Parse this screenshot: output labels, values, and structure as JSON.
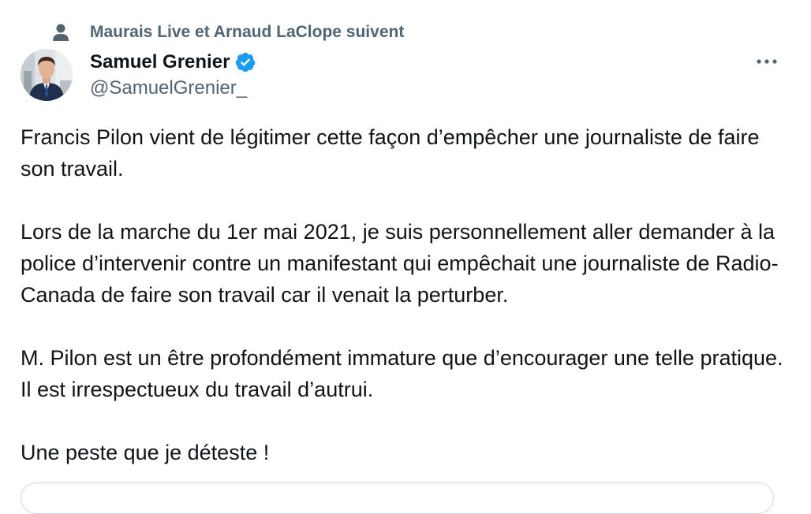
{
  "social_context": {
    "icon": "person-icon",
    "text": "Maurais Live et Arnaud LaClope suivent"
  },
  "author": {
    "display_name": "Samuel Grenier",
    "handle": "@SamuelGrenier_",
    "verified": true,
    "avatar_icon": "profile-photo"
  },
  "more_menu": {
    "icon": "more-dots-icon"
  },
  "tweet": {
    "paragraphs": [
      "Francis Pilon vient de légitimer cette façon d’empêcher une journaliste de faire son travail.",
      "Lors de la marche du 1er mai 2021, je suis personnellement aller demander à la police d’intervenir contre un manifestant qui empêchait une journaliste de Radio-Canada de faire son travail car il venait la perturber.",
      "M. Pilon est un être profondément immature que d’encourager une telle pratique.  Il est irrespectueux du travail d’autrui.",
      "Une peste que je déteste !"
    ]
  },
  "colors": {
    "text_primary": "#0f1419",
    "text_secondary": "#536471",
    "verified_blue": "#1d9bf0",
    "border": "#cfd9de"
  }
}
